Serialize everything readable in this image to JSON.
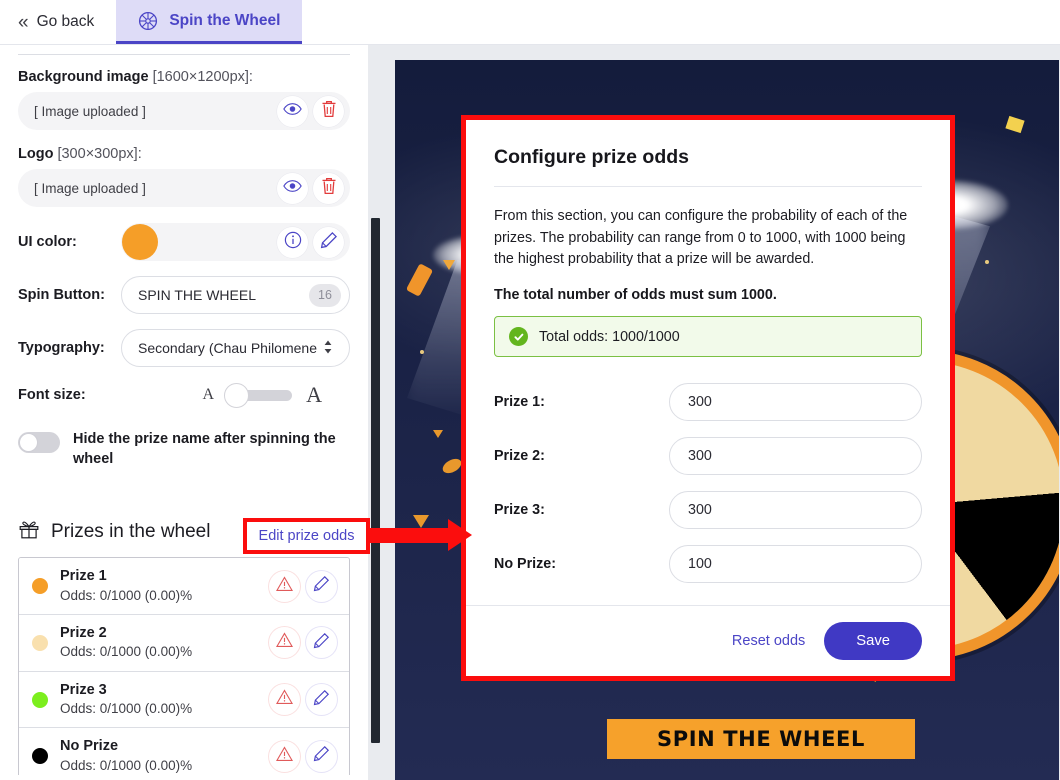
{
  "topbar": {
    "go_back": "Go back",
    "tab_label": "Spin the Wheel",
    "back_chevron": "«",
    "tab_icon": "wheel-icon"
  },
  "sidebar": {
    "background_image": {
      "label_bold": "Background image",
      "label_dim": "[1600×1200px]:",
      "value": "[ Image uploaded ]",
      "preview_icon": "eye-icon",
      "delete_icon": "trash-icon"
    },
    "logo": {
      "label_bold": "Logo",
      "label_dim": "[300×300px]:",
      "value": "[ Image uploaded ]",
      "preview_icon": "eye-icon",
      "delete_icon": "trash-icon"
    },
    "ui_color": {
      "label": "UI color:",
      "color": "#F59E28",
      "info_icon": "info-icon",
      "edit_icon": "pencil-icon"
    },
    "spin_button": {
      "label": "Spin Button:",
      "value": "SPIN THE WHEEL",
      "counter": "16"
    },
    "typography": {
      "label": "Typography:",
      "value": "Secondary (Chau Philomene",
      "caret_icon": "select-updown-icon"
    },
    "font_size": {
      "label": "Font size:",
      "small_glyph": "A",
      "large_glyph": "A",
      "slider_position_pct": 5
    },
    "hide_prize_toggle": {
      "label": "Hide the prize name after spinning the wheel",
      "state": "off"
    },
    "prizes_section": {
      "icon": "gift-icon",
      "title": "Prizes in the wheel",
      "edit_link": "Edit prize odds",
      "items": [
        {
          "name": "Prize 1",
          "odds": "Odds: 0/1000 (0.00)%",
          "color": "#F59E28"
        },
        {
          "name": "Prize 2",
          "odds": "Odds: 0/1000 (0.00)%",
          "color": "#F9E0AE"
        },
        {
          "name": "Prize 3",
          "odds": "Odds: 0/1000 (0.00)%",
          "color": "#7CEE1E"
        },
        {
          "name": "No Prize",
          "odds": "Odds: 0/1000 (0.00)%",
          "color": "#000000"
        }
      ],
      "warn_icon": "warning-triangle-icon",
      "edit_icon": "pencil-icon"
    }
  },
  "preview": {
    "spin_button_label": "SPIN THE WHEEL",
    "background_color": "#1b2347",
    "accent_color": "#F6A12B"
  },
  "modal": {
    "title": "Configure prize odds",
    "description": "From this section, you can configure the probability of each of the prizes. The probability can range from 0 to 1000, with 1000 being the highest probability that a prize will be awarded.",
    "emphasis": "The total number of odds must sum 1000.",
    "total_banner": {
      "text": "Total odds: 1000/1000",
      "icon": "check-circle-icon",
      "status_color": "#63B51E"
    },
    "fields": [
      {
        "label": "Prize 1:",
        "value": "300"
      },
      {
        "label": "Prize 2:",
        "value": "300"
      },
      {
        "label": "Prize 3:",
        "value": "300"
      },
      {
        "label": "No Prize:",
        "value": "100"
      }
    ],
    "reset_label": "Reset odds",
    "save_label": "Save",
    "highlight_color": "#FB0D0D"
  },
  "annotation": {
    "callout_label": "Edit prize odds",
    "arrow_color": "#FB0D0D"
  }
}
